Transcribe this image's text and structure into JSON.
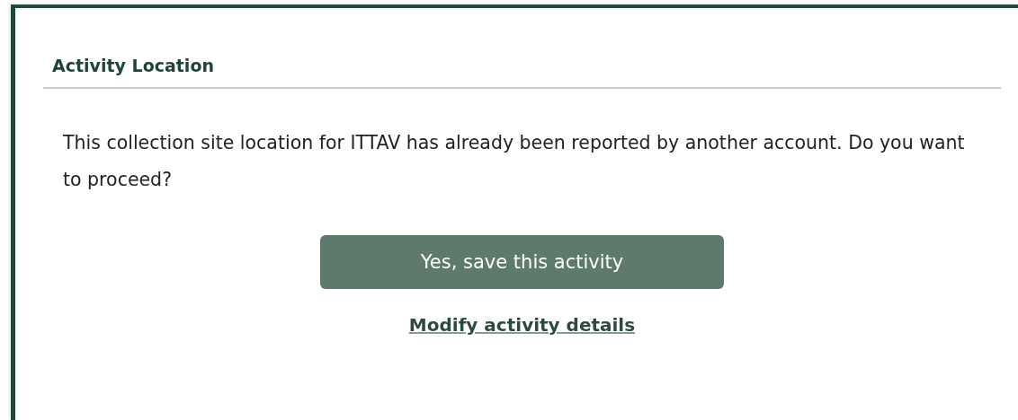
{
  "dialog": {
    "title": "Activity Location",
    "message": "This collection site location for ITTAV has already been reported by another account. Do you want to proceed?",
    "primary_button": "Yes, save this activity",
    "secondary_link": "Modify activity details"
  }
}
